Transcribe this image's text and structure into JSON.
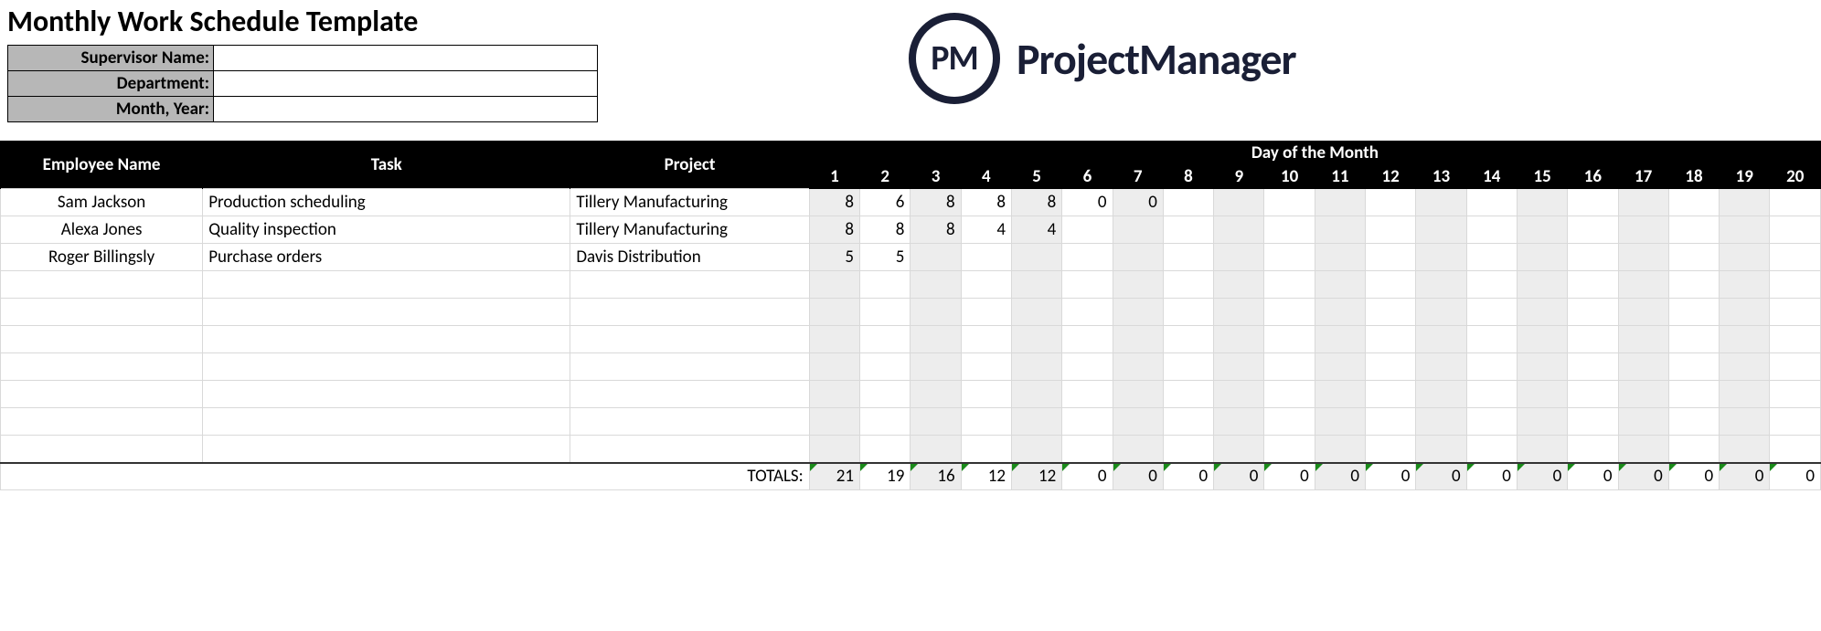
{
  "title": "Monthly Work Schedule Template",
  "meta": {
    "supervisor_label": "Supervisor Name:",
    "supervisor_value": "",
    "department_label": "Department:",
    "department_value": "",
    "month_label": "Month, Year:",
    "month_value": ""
  },
  "logo": {
    "mark": "PM",
    "text": "ProjectManager"
  },
  "headers": {
    "employee": "Employee Name",
    "task": "Task",
    "project": "Project",
    "day_of_month": "Day of the Month"
  },
  "days": [
    "1",
    "2",
    "3",
    "4",
    "5",
    "6",
    "7",
    "8",
    "9",
    "10",
    "11",
    "12",
    "13",
    "14",
    "15",
    "16",
    "17",
    "18",
    "19",
    "20"
  ],
  "rows": [
    {
      "employee": "Sam Jackson",
      "task": "Production scheduling",
      "project": "Tillery Manufacturing",
      "hours": [
        "8",
        "6",
        "8",
        "8",
        "8",
        "0",
        "0",
        "",
        "",
        "",
        "",
        "",
        "",
        "",
        "",
        "",
        "",
        "",
        "",
        ""
      ]
    },
    {
      "employee": "Alexa Jones",
      "task": "Quality inspection",
      "project": "Tillery Manufacturing",
      "hours": [
        "8",
        "8",
        "8",
        "4",
        "4",
        "",
        "",
        "",
        "",
        "",
        "",
        "",
        "",
        "",
        "",
        "",
        "",
        "",
        "",
        ""
      ]
    },
    {
      "employee": "Roger Billingsly",
      "task": "Purchase orders",
      "project": "Davis Distribution",
      "hours": [
        "5",
        "5",
        "",
        "",
        "",
        "",
        "",
        "",
        "",
        "",
        "",
        "",
        "",
        "",
        "",
        "",
        "",
        "",
        "",
        ""
      ]
    },
    {
      "employee": "",
      "task": "",
      "project": "",
      "hours": [
        "",
        "",
        "",
        "",
        "",
        "",
        "",
        "",
        "",
        "",
        "",
        "",
        "",
        "",
        "",
        "",
        "",
        "",
        "",
        ""
      ]
    },
    {
      "employee": "",
      "task": "",
      "project": "",
      "hours": [
        "",
        "",
        "",
        "",
        "",
        "",
        "",
        "",
        "",
        "",
        "",
        "",
        "",
        "",
        "",
        "",
        "",
        "",
        "",
        ""
      ]
    },
    {
      "employee": "",
      "task": "",
      "project": "",
      "hours": [
        "",
        "",
        "",
        "",
        "",
        "",
        "",
        "",
        "",
        "",
        "",
        "",
        "",
        "",
        "",
        "",
        "",
        "",
        "",
        ""
      ]
    },
    {
      "employee": "",
      "task": "",
      "project": "",
      "hours": [
        "",
        "",
        "",
        "",
        "",
        "",
        "",
        "",
        "",
        "",
        "",
        "",
        "",
        "",
        "",
        "",
        "",
        "",
        "",
        ""
      ]
    },
    {
      "employee": "",
      "task": "",
      "project": "",
      "hours": [
        "",
        "",
        "",
        "",
        "",
        "",
        "",
        "",
        "",
        "",
        "",
        "",
        "",
        "",
        "",
        "",
        "",
        "",
        "",
        ""
      ]
    },
    {
      "employee": "",
      "task": "",
      "project": "",
      "hours": [
        "",
        "",
        "",
        "",
        "",
        "",
        "",
        "",
        "",
        "",
        "",
        "",
        "",
        "",
        "",
        "",
        "",
        "",
        "",
        ""
      ]
    },
    {
      "employee": "",
      "task": "",
      "project": "",
      "hours": [
        "",
        "",
        "",
        "",
        "",
        "",
        "",
        "",
        "",
        "",
        "",
        "",
        "",
        "",
        "",
        "",
        "",
        "",
        "",
        ""
      ]
    }
  ],
  "totals_label": "TOTALS:",
  "totals": [
    "21",
    "19",
    "16",
    "12",
    "12",
    "0",
    "0",
    "0",
    "0",
    "0",
    "0",
    "0",
    "0",
    "0",
    "0",
    "0",
    "0",
    "0",
    "0",
    "0"
  ]
}
